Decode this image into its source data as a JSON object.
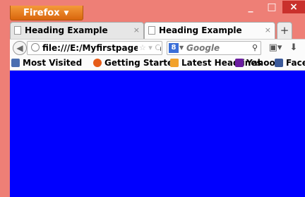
{
  "app": {
    "button_label": "Firefox"
  },
  "window_controls": {
    "minimize": "_",
    "maximize": "□",
    "close": "×"
  },
  "tabs": [
    {
      "title": "Heading Example",
      "active": false
    },
    {
      "title": "Heading Example",
      "active": true
    }
  ],
  "newtab": "+",
  "navbar": {
    "url": "file:///E:/Myfirstpage.html",
    "url_icons": "☆ ▾ C",
    "search_engine": "8",
    "search_placeholder": "Google"
  },
  "bookmarks": [
    {
      "label": "Most Visited"
    },
    {
      "label": "Getting Started"
    },
    {
      "label": "Latest Headlines"
    },
    {
      "label": "Yahoo"
    },
    {
      "label": "Facebook"
    }
  ],
  "colors": {
    "titlebar": "#ee7f76",
    "firefox_button": "#e8741a",
    "content": "#0000ff",
    "close_button": "#c9302c"
  }
}
